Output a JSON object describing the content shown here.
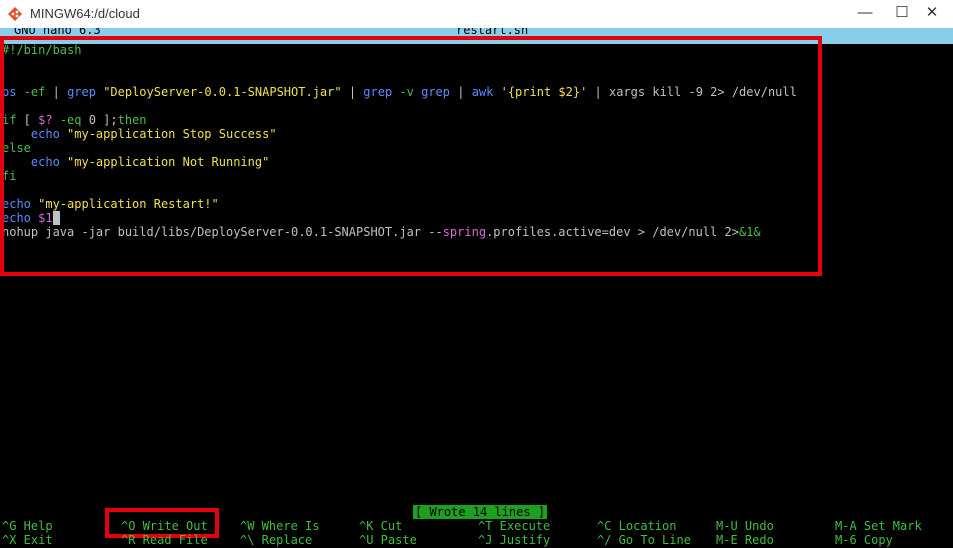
{
  "window": {
    "title": "MINGW64:/d/cloud",
    "minimize": "—",
    "maximize": "☐",
    "close": "✕"
  },
  "nano_header": {
    "left": "GNU nano 6.3",
    "center": "restart.sh"
  },
  "lines": [
    [
      {
        "t": "#!/bin/bash",
        "c": "g"
      }
    ],
    [],
    [],
    [
      {
        "t": "ps ",
        "c": "b"
      },
      {
        "t": "-ef",
        "c": "g"
      },
      {
        "t": " | ",
        "c": "w"
      },
      {
        "t": "grep ",
        "c": "b"
      },
      {
        "t": "\"DeployServer-0.0.1-SNAPSHOT.jar\"",
        "c": "y"
      },
      {
        "t": " | ",
        "c": "w"
      },
      {
        "t": "grep ",
        "c": "b"
      },
      {
        "t": "-v ",
        "c": "g"
      },
      {
        "t": "grep",
        "c": "b"
      },
      {
        "t": " | ",
        "c": "w"
      },
      {
        "t": "awk ",
        "c": "b"
      },
      {
        "t": "'{print $2}'",
        "c": "y"
      },
      {
        "t": " | ",
        "c": "w"
      },
      {
        "t": "xargs kill -9 2> /dev/null",
        "c": "w"
      }
    ],
    [],
    [
      {
        "t": "if",
        "c": "g"
      },
      {
        "t": " [ ",
        "c": "w"
      },
      {
        "t": "$?",
        "c": "m"
      },
      {
        "t": " -eq",
        "c": "g"
      },
      {
        "t": " 0 ];",
        "c": "w"
      },
      {
        "t": "then",
        "c": "g"
      }
    ],
    [
      {
        "t": "    echo ",
        "c": "b"
      },
      {
        "t": "\"my-application Stop Success\"",
        "c": "y"
      }
    ],
    [
      {
        "t": "else",
        "c": "g"
      }
    ],
    [
      {
        "t": "    echo ",
        "c": "b"
      },
      {
        "t": "\"my-application Not Running\"",
        "c": "y"
      }
    ],
    [
      {
        "t": "fi",
        "c": "g"
      }
    ],
    [],
    [
      {
        "t": "echo ",
        "c": "b"
      },
      {
        "t": "\"my-application Restart!\"",
        "c": "y"
      }
    ],
    [
      {
        "t": "echo ",
        "c": "b"
      },
      {
        "t": "$1",
        "c": "m"
      },
      {
        "t": " ",
        "c": "cursor"
      }
    ],
    [
      {
        "t": "nohup java -jar build/libs/DeployServer-0.0.1-SNAPSHOT.jar --",
        "c": "w"
      },
      {
        "t": "spring",
        "c": "m"
      },
      {
        "t": ".profiles.active=dev > /dev/null 2>",
        "c": "w"
      },
      {
        "t": "&1&",
        "c": "g"
      }
    ]
  ],
  "status_message": "[ Wrote 14 lines ]",
  "shortcuts_row1": [
    {
      "key": "^G",
      "label": "Help"
    },
    {
      "key": "^O",
      "label": "Write Out"
    },
    {
      "key": "^W",
      "label": "Where Is"
    },
    {
      "key": "^K",
      "label": "Cut"
    },
    {
      "key": "^T",
      "label": "Execute"
    },
    {
      "key": "^C",
      "label": "Location"
    },
    {
      "key": "M-U",
      "label": "Undo"
    },
    {
      "key": "M-A",
      "label": "Set Mark"
    }
  ],
  "shortcuts_row2": [
    {
      "key": "^X",
      "label": "Exit"
    },
    {
      "key": "^R",
      "label": "Read File"
    },
    {
      "key": "^\\",
      "label": "Replace"
    },
    {
      "key": "^U",
      "label": "Paste"
    },
    {
      "key": "^J",
      "label": "Justify"
    },
    {
      "key": "^/",
      "label": "Go To Line"
    },
    {
      "key": "M-E",
      "label": "Redo"
    },
    {
      "key": "M-6",
      "label": "Copy"
    }
  ]
}
